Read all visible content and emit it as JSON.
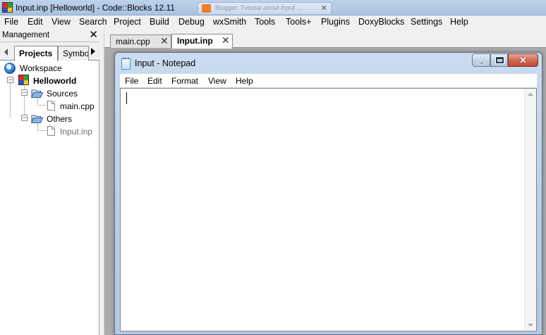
{
  "window": {
    "title": "Input.inp [Helloworld] - Code::Blocks 12.11",
    "background_tab_label": "Blogger: Tutorial about Input ..."
  },
  "menubar": {
    "items": [
      "File",
      "Edit",
      "View",
      "Search",
      "Project",
      "Build",
      "Debug",
      "wxSmith",
      "Tools",
      "Tools+",
      "Plugins",
      "DoxyBlocks",
      "Settings",
      "Help"
    ]
  },
  "management": {
    "title": "Management",
    "close_label": "✕",
    "tabs": [
      "Projects",
      "Symbo"
    ],
    "tree": {
      "workspace": "Workspace",
      "project": "Helloworld",
      "sources": "Sources",
      "sources_file": "main.cpp",
      "others": "Others",
      "others_file": "Input.inp"
    }
  },
  "editor": {
    "tabs": [
      {
        "label": "main.cpp",
        "close": "✕"
      },
      {
        "label": "Input.inp",
        "close": "✕"
      }
    ],
    "active_tab": "Input.inp"
  },
  "notepad": {
    "title": "Input - Notepad",
    "close_glyph": "✕",
    "menu": [
      "File",
      "Edit",
      "Format",
      "View",
      "Help"
    ],
    "text": ""
  },
  "colors": {
    "titlebar": "#bcd2ea",
    "logo": [
      "#e8262a",
      "#2aa82a",
      "#2a52c8",
      "#f2c81a"
    ]
  },
  "icons": [
    "codeblocks-logo-icon",
    "workspace-icon",
    "project-icon",
    "folder-open-icon",
    "file-icon",
    "notepad-icon"
  ]
}
